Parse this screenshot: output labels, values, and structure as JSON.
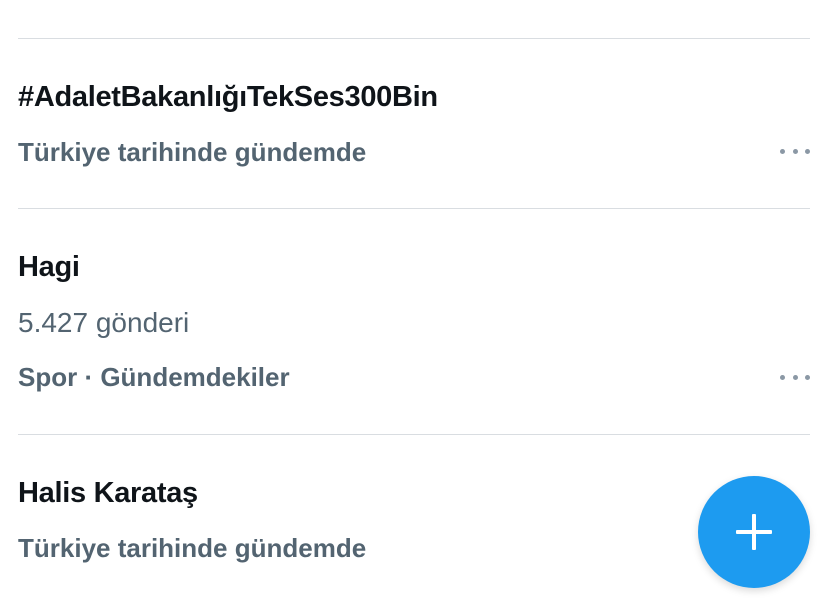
{
  "trends": [
    {
      "title": "#AdaletBakanlığıTekSes300Bin",
      "context": "Türkiye tarihinde gündemde"
    },
    {
      "title": "Hagi",
      "count": "5.427 gönderi",
      "context": "Spor · Gündemdekiler"
    },
    {
      "title": "Halis Karataş",
      "context": "Türkiye tarihinde gündemde"
    }
  ],
  "icons": {
    "more": "more-horizontal-icon",
    "compose": "plus-icon"
  },
  "colors": {
    "primary_text": "#0f1419",
    "secondary_text": "#536471",
    "accent": "#1d9bf0",
    "divider": "#d9dde1"
  }
}
